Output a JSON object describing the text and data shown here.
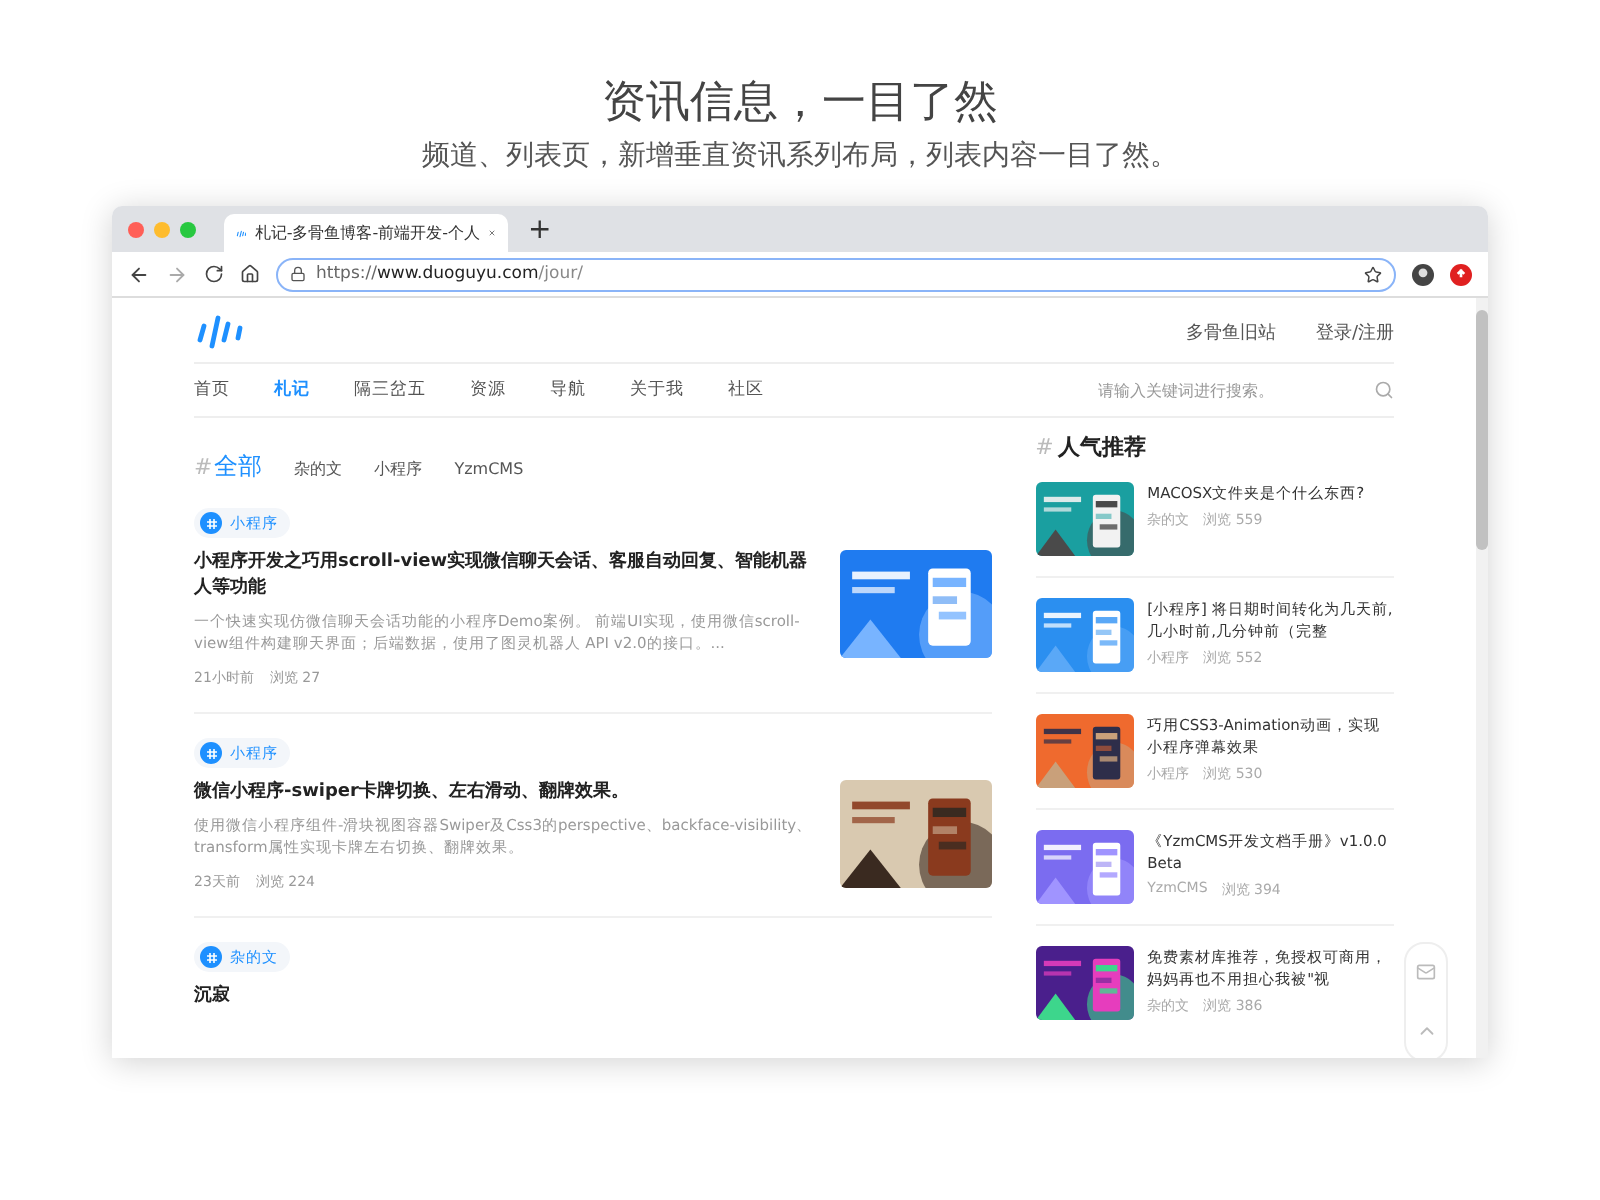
{
  "headline": "资讯信息，一目了然",
  "subheadline": "频道、列表页，新增垂直资讯系列布局，列表内容一目了然。",
  "browser": {
    "tab_title": "札记-多骨鱼博客-前端开发-个人",
    "new_tab": "+",
    "url_scheme": "https://",
    "url_host": "www.duoguyu.com",
    "url_path": "/jour/"
  },
  "site": {
    "header_links": [
      "多骨鱼旧站",
      "登录/注册"
    ],
    "nav": [
      {
        "label": "首页",
        "selected": false
      },
      {
        "label": "札记",
        "selected": true
      },
      {
        "label": "隔三岔五",
        "selected": false
      },
      {
        "label": "资源",
        "selected": false
      },
      {
        "label": "导航",
        "selected": false
      },
      {
        "label": "关于我",
        "selected": false
      },
      {
        "label": "社区",
        "selected": false
      }
    ],
    "search": {
      "placeholder": "请输入关键词进行搜索。"
    },
    "filter_mark": "#",
    "filters": [
      {
        "label": "全部",
        "selected": true
      },
      {
        "label": "杂的文",
        "selected": false
      },
      {
        "label": "小程序",
        "selected": false
      },
      {
        "label": "YzmCMS",
        "selected": false
      }
    ],
    "articles": [
      {
        "tag": "小程序",
        "title": "小程序开发之巧用scroll-view实现微信聊天会话、客服自动回复、智能机器人等功能",
        "summary": "一个快速实现仿微信聊天会话功能的小程序Demo案例。 前端UI实现，使用微信scroll-view组件构建聊天界面；后端数据，使用了图灵机器人 API v2.0的接口。...",
        "time": "21小时前",
        "views": "浏览 27"
      },
      {
        "tag": "小程序",
        "title": "微信小程序-swiper卡牌切换、左右滑动、翻牌效果。",
        "summary": "使用微信小程序组件-滑块视图容器Swiper及Css3的perspective、backface-visibility、transform属性实现卡牌左右切换、翻牌效果。",
        "time": "23天前",
        "views": "浏览 224"
      },
      {
        "tag": "杂的文",
        "title": "沉寂"
      }
    ],
    "sidebar": {
      "mark": "#",
      "title": "人气推荐",
      "items": [
        {
          "title": "MACOSX文件夹是个什么东西?",
          "category": "杂的文",
          "views": "浏览 559"
        },
        {
          "title": "[小程序] 将日期时间转化为几天前,几小时前,几分钟前（完整",
          "category": "小程序",
          "views": "浏览 552"
        },
        {
          "title": "巧用CSS3-Animation动画，实现小程序弹幕效果",
          "category": "小程序",
          "views": "浏览 530"
        },
        {
          "title": "《YzmCMS开发文档手册》v1.0.0 Beta",
          "category": "YzmCMS",
          "views": "浏览 394"
        },
        {
          "title": "免费素材库推荐，免授权可商用，妈妈再也不用担心我被\"视",
          "category": "杂的文",
          "views": "浏览 386"
        }
      ]
    }
  }
}
